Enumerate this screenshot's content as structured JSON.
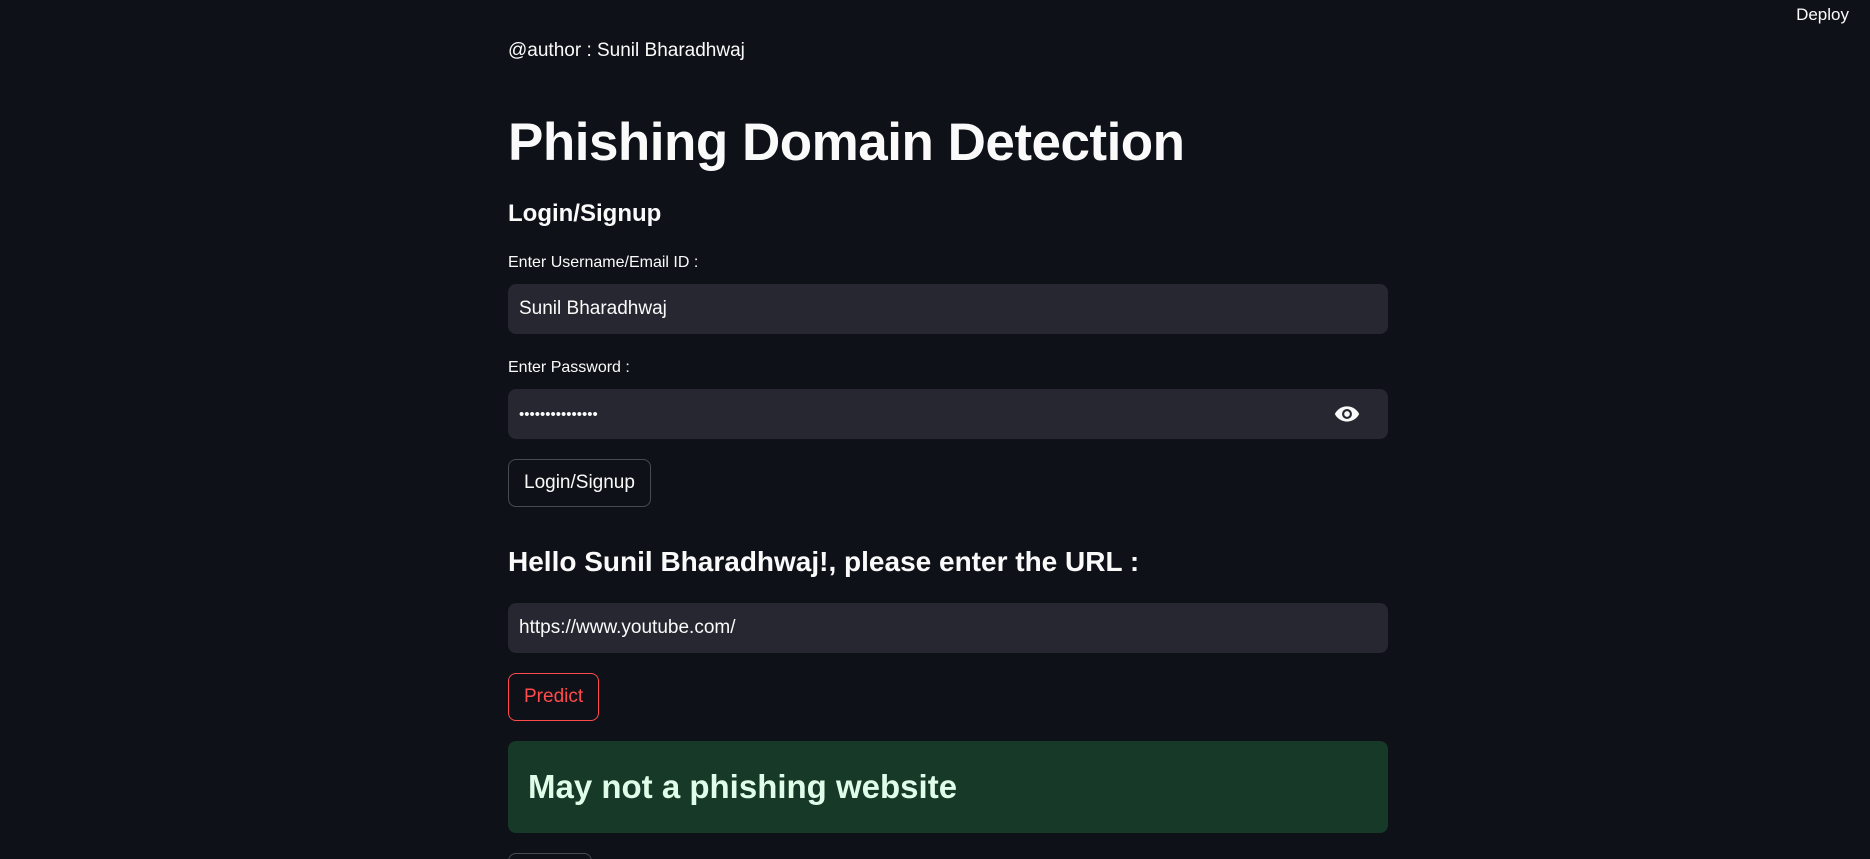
{
  "header": {
    "deploy_label": "Deploy"
  },
  "author": "@author : Sunil Bharadhwaj",
  "title": "Phishing Domain Detection",
  "login_section": {
    "heading": "Login/Signup",
    "username_label": "Enter Username/Email ID :",
    "username_value": "Sunil Bharadhwaj",
    "password_label": "Enter Password :",
    "password_value": "•••••••••••••••",
    "password_toggle_icon": "eye-icon",
    "submit_label": "Login/Signup"
  },
  "url_section": {
    "greeting": "Hello Sunil Bharadhwaj!, please enter the URL :",
    "url_value": "https://www.youtube.com/",
    "predict_label": "Predict"
  },
  "result": {
    "message": "May not a phishing website",
    "background_color": "#173928"
  },
  "colors": {
    "background": "#0e1117",
    "input_background": "#262730",
    "accent": "#ff4b4b"
  }
}
